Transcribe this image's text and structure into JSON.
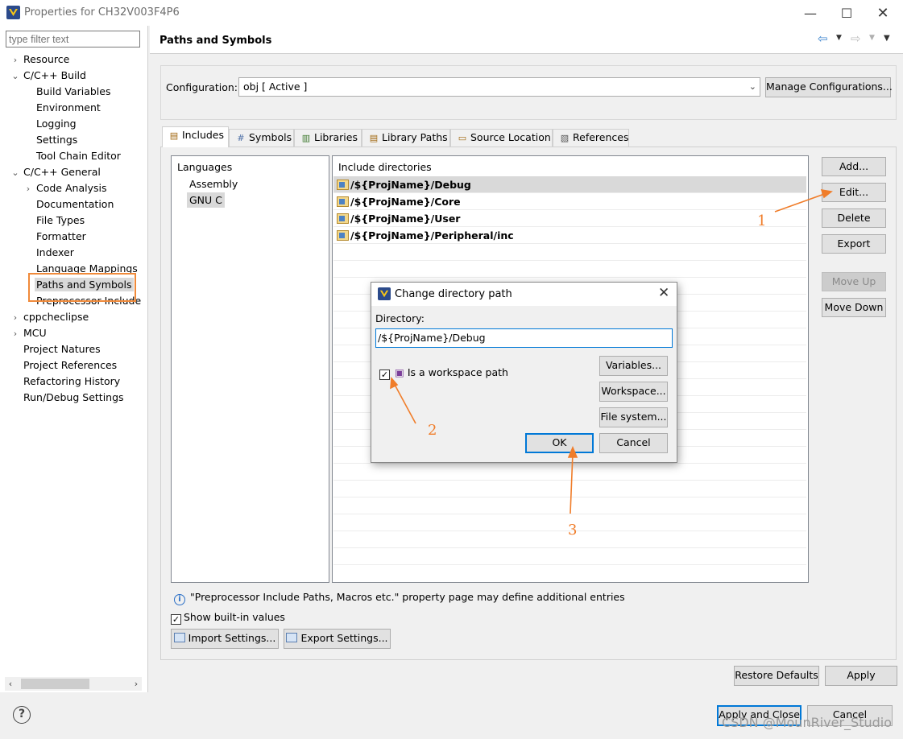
{
  "window": {
    "title": "Properties for CH32V003F4P6",
    "colors": {
      "accent": "#0078d7",
      "annotation": "#f07d2a"
    }
  },
  "sidebar": {
    "filter_placeholder": "type filter text",
    "items": [
      {
        "label": "Resource",
        "arrow": "›"
      },
      {
        "label": "C/C++ Build",
        "arrow": "⌄"
      },
      {
        "label": "Build Variables"
      },
      {
        "label": "Environment"
      },
      {
        "label": "Logging"
      },
      {
        "label": "Settings"
      },
      {
        "label": "Tool Chain Editor"
      },
      {
        "label": "C/C++ General",
        "arrow": "⌄"
      },
      {
        "label": "Code Analysis",
        "arrow": "›"
      },
      {
        "label": "Documentation"
      },
      {
        "label": "File Types"
      },
      {
        "label": "Formatter"
      },
      {
        "label": "Indexer"
      },
      {
        "label": "Language Mappings"
      },
      {
        "label": "Paths and Symbols",
        "selected": true
      },
      {
        "label": "Preprocessor Include"
      },
      {
        "label": "cppcheclipse",
        "arrow": "›"
      },
      {
        "label": "MCU",
        "arrow": "›"
      },
      {
        "label": "Project Natures"
      },
      {
        "label": "Project References"
      },
      {
        "label": "Refactoring History"
      },
      {
        "label": "Run/Debug Settings"
      }
    ]
  },
  "page": {
    "title": "Paths and Symbols",
    "configuration_label": "Configuration:",
    "configuration_value": "obj  [ Active ]",
    "manage_button": "Manage Configurations...",
    "tabs": [
      {
        "label": "Includes",
        "icon": "includes-icon",
        "glyph": "▤"
      },
      {
        "label": "Symbols",
        "icon": "hash-icon",
        "glyph": "#"
      },
      {
        "label": "Libraries",
        "icon": "library-icon",
        "glyph": "▥"
      },
      {
        "label": "Library Paths",
        "icon": "library-path-icon",
        "glyph": "▤"
      },
      {
        "label": "Source Location",
        "icon": "source-folder-icon",
        "glyph": "▭"
      },
      {
        "label": "References",
        "icon": "references-icon",
        "glyph": "▧"
      }
    ],
    "languages_header": "Languages",
    "languages": [
      "Assembly",
      "GNU C"
    ],
    "selected_language": "GNU C",
    "include_header": "Include directories",
    "include_dirs": [
      "/${ProjName}/Debug",
      "/${ProjName}/Core",
      "/${ProjName}/User",
      "/${ProjName}/Peripheral/inc"
    ],
    "side_buttons": {
      "add": "Add...",
      "edit": "Edit...",
      "delete": "Delete",
      "export": "Export",
      "move_up": "Move Up",
      "move_down": "Move Down"
    },
    "info_text": "\"Preprocessor Include Paths, Macros etc.\" property page may define additional entries",
    "show_builtin": "Show built-in values",
    "show_builtin_checked": true,
    "import_settings": "Import Settings...",
    "export_settings": "Export Settings...",
    "restore_defaults": "Restore Defaults",
    "apply": "Apply"
  },
  "dialog": {
    "title": "Change directory path",
    "directory_label": "Directory:",
    "directory_value": "/${ProjName}/Debug",
    "workspace_checkbox": "Is a workspace path",
    "workspace_checked": true,
    "variables": "Variables...",
    "workspace": "Workspace...",
    "file_system": "File system...",
    "ok": "OK",
    "cancel": "Cancel"
  },
  "footer": {
    "apply_and_close": "Apply and Close",
    "cancel": "Cancel",
    "watermark": "CSDN @MounRiver_Studio"
  },
  "annotations": [
    "1",
    "2",
    "3"
  ]
}
